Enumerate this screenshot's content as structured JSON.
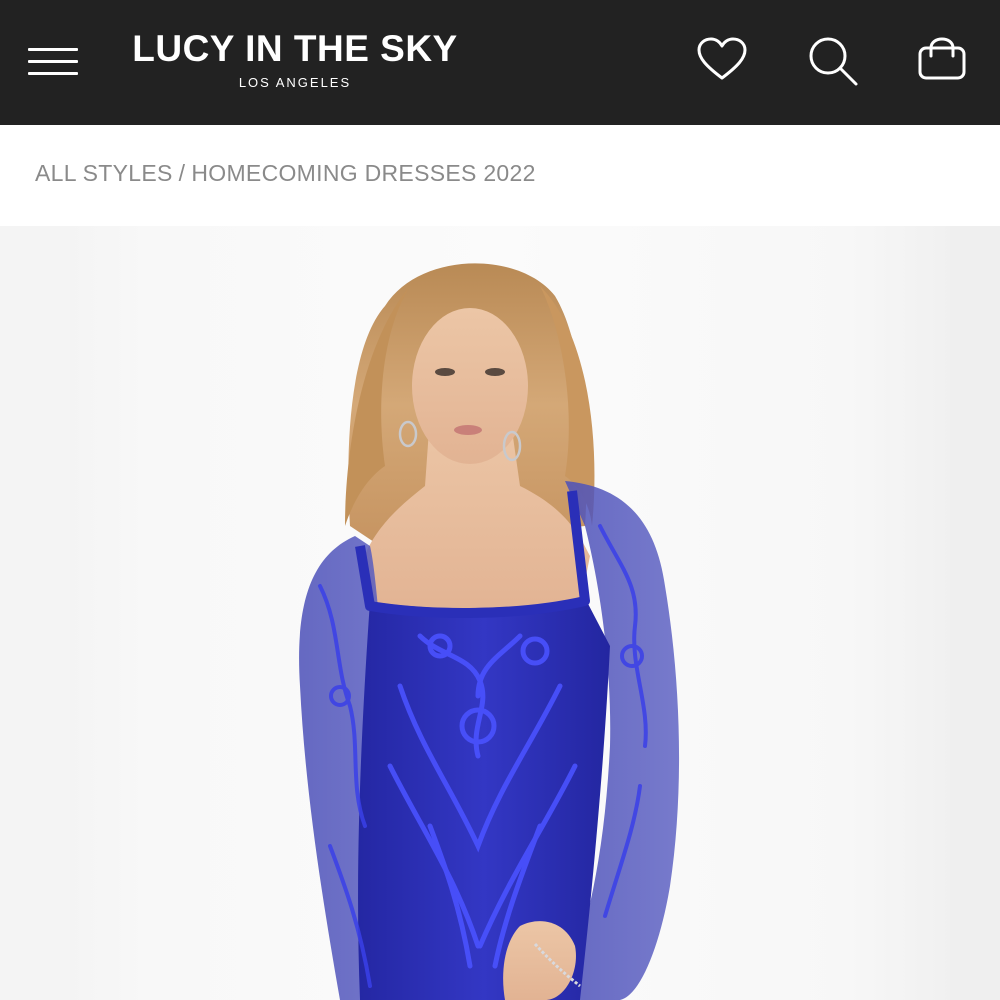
{
  "header": {
    "brand_name": "LUCY IN THE SKY",
    "brand_location": "LOS ANGELES",
    "icons": {
      "menu": "hamburger-menu-icon",
      "wishlist": "heart-icon",
      "search": "search-icon",
      "cart": "shopping-bag-icon"
    },
    "background_color": "#222222",
    "foreground_color": "#ffffff"
  },
  "breadcrumb": {
    "items": [
      "ALL STYLES",
      "HOMECOMING DRESSES 2022"
    ],
    "separator": "/"
  },
  "product": {
    "dress_color": "#2a2fb8"
  }
}
